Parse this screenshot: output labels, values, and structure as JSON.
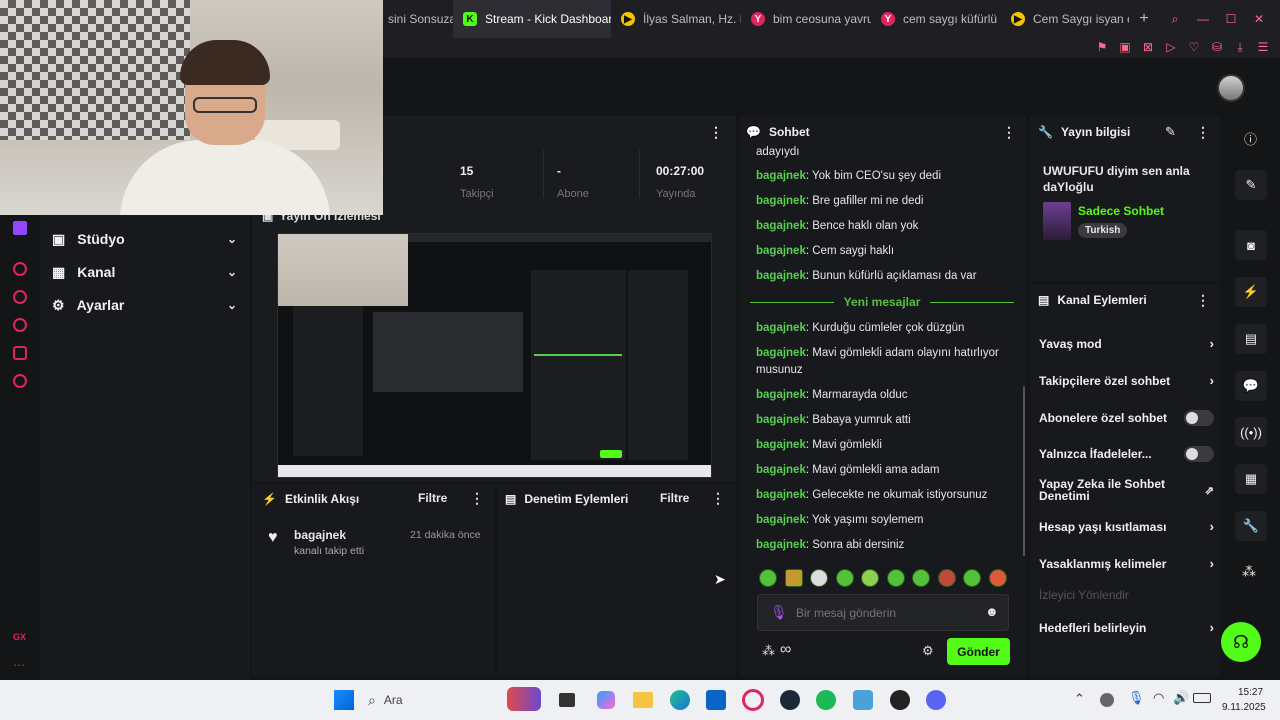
{
  "browser": {
    "tabs": [
      {
        "label": "sini Sonsuza",
        "icon": "page-icon"
      },
      {
        "label": "Stream - Kick Dashboard",
        "icon": "kick-icon",
        "active": true
      },
      {
        "label": "İlyas Salman, Hz. M",
        "icon": "youtube-icon"
      },
      {
        "label": "bim ceosuna yavru",
        "icon": "yandex-icon"
      },
      {
        "label": "cem saygı küfürlü a",
        "icon": "yandex-icon"
      },
      {
        "label": "Cem Saygı isyan etti",
        "icon": "youtube-icon"
      }
    ],
    "new_tab": "+"
  },
  "stats": {
    "items": [
      {
        "value": "15",
        "label": "Takipçi"
      },
      {
        "value": "-",
        "label": "Abone"
      },
      {
        "value": "00:27:00",
        "label": "Yayında"
      }
    ],
    "partial_label": "...üçi"
  },
  "preview": {
    "title": "Yayın Ön İzlemesi"
  },
  "sidebar": {
    "items": [
      {
        "label": "Stüdyo",
        "icon": "studio-icon"
      },
      {
        "label": "Kanal",
        "icon": "channel-icon"
      },
      {
        "label": "Ayarlar",
        "icon": "settings-icon"
      }
    ],
    "bottom_logo": "GX"
  },
  "activity": {
    "title": "Etkinlik Akışı",
    "filter": "Filtre",
    "event": {
      "user": "bagajnek",
      "text": "kanalı takip etti",
      "time": "21 dakika önce"
    }
  },
  "moderation": {
    "title": "Denetim Eylemleri",
    "filter": "Filtre"
  },
  "chat": {
    "title": "Sohbet",
    "top_partial": "adayıydı",
    "messages_before": [
      {
        "user": "bagajnek",
        "text": "Yok bim CEO'su şey dedi"
      },
      {
        "user": "bagajnek",
        "text": "Bre gafiller mi ne dedi"
      },
      {
        "user": "bagajnek",
        "text": "Bence haklı olan yok"
      },
      {
        "user": "bagajnek",
        "text": "Cem saygi haklı"
      },
      {
        "user": "bagajnek",
        "text": "Bunun küfürlü açıklaması da var"
      }
    ],
    "new_messages_label": "Yeni mesajlar",
    "messages_after": [
      {
        "user": "bagajnek",
        "text": "Kurduğu cümleler çok düzgün"
      },
      {
        "user": "bagajnek",
        "text": "Mavi gömlekli adam olayını hatırlıyor musunuz"
      },
      {
        "user": "bagajnek",
        "text": "Marmarayda olduc"
      },
      {
        "user": "bagajnek",
        "text": "Babaya yumruk atti"
      },
      {
        "user": "bagajnek",
        "text": "Mavi gömlekli"
      },
      {
        "user": "bagajnek",
        "text": "Mavi gömlekli ama adam"
      },
      {
        "user": "bagajnek",
        "text": "Gelecekte ne okumak istiyorsunuz"
      },
      {
        "user": "bagajnek",
        "text": "Yok yaşımı soylemem"
      },
      {
        "user": "bagajnek",
        "text": "Sonra abi dersiniz"
      }
    ],
    "input_placeholder": "Bir mesaj gönderin",
    "send_label": "Gönder"
  },
  "info": {
    "title": "Yayın bilgisi",
    "stream_title": "UWUFUFU diyim sen anla daYloğlu",
    "category": "Sadece Sohbet",
    "language": "Turkish"
  },
  "channel_actions": {
    "title": "Kanal Eylemleri",
    "items": [
      {
        "label": "Yavaş mod",
        "control": "chevron"
      },
      {
        "label": "Takipçilere özel sohbet",
        "control": "chevron"
      },
      {
        "label": "Abonelere özel sohbet",
        "control": "toggle"
      },
      {
        "label": "Yalnızca İfadeleler...",
        "control": "toggle"
      },
      {
        "label": "Yapay Zeka ile Sohbet Denetimi",
        "control": "external"
      },
      {
        "label": "Hesap yaşı kısıtlaması",
        "control": "chevron"
      },
      {
        "label": "Yasaklanmış kelimeler",
        "control": "chevron"
      },
      {
        "label": "İzleyici Yönlendir",
        "control": "none",
        "disabled": true
      },
      {
        "label": "Hedefleri belirleyin",
        "control": "chevron"
      }
    ]
  },
  "taskbar": {
    "search_placeholder": "Ara",
    "time": "15:27",
    "date": "9.11.2025"
  },
  "colors": {
    "accent": "#53fc18",
    "kick_green": "#57d04f",
    "bg": "#141517",
    "panel": "#18191c"
  }
}
